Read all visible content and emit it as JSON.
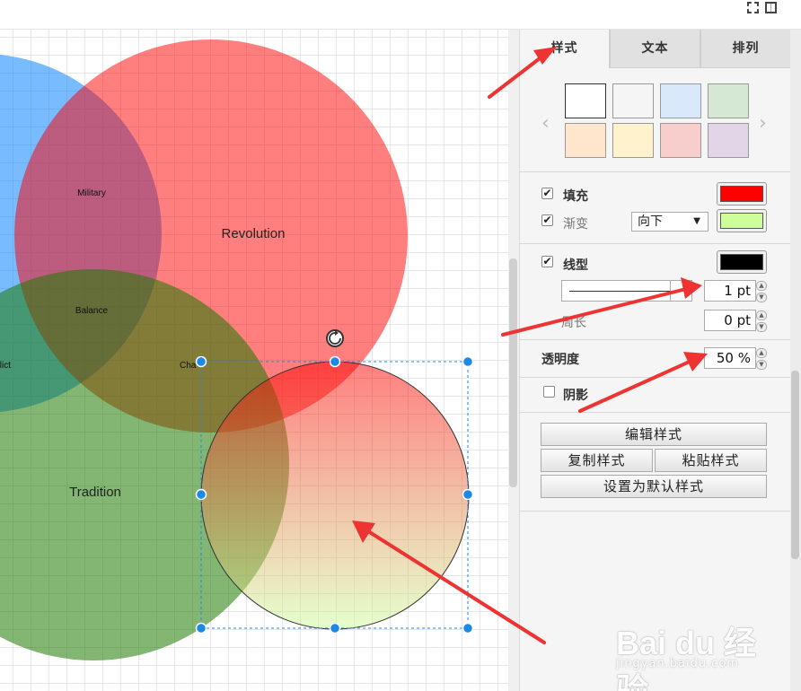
{
  "diagram": {
    "labels": {
      "revolution": "Revolution",
      "military": "Military",
      "balance": "Balance",
      "conflict": "flict",
      "chaos": "Cha",
      "tradition": "Tradition"
    }
  },
  "panel": {
    "tabs": [
      "样式",
      "文本",
      "排列"
    ],
    "swatch_colors": [
      "#ffffff",
      "#f5f5f5",
      "#dae8fc",
      "#d5e8d4",
      "#ffe6cc",
      "#fff2cc",
      "#f8cecc",
      "#e1d5e7"
    ],
    "fill": {
      "label": "填充",
      "checked": true,
      "color": "#ff0000"
    },
    "gradient": {
      "label": "渐变",
      "checked": true,
      "direction": "向下",
      "color": "#ccff99"
    },
    "line": {
      "label": "线型",
      "checked": true,
      "color": "#000000",
      "width": "1 pt"
    },
    "perimeter": {
      "label": "周长",
      "value": "0 pt"
    },
    "opacity": {
      "label": "透明度",
      "value": "50 %"
    },
    "shadow": {
      "label": "阴影",
      "checked": false
    },
    "buttons": {
      "edit_style": "编辑样式",
      "copy_style": "复制样式",
      "paste_style": "粘贴样式",
      "set_default": "设置为默认样式"
    }
  },
  "watermark": {
    "main": "Bai du 经验",
    "sub": "jingyan.baidu.com"
  },
  "colors": {
    "annotation_arrow": "#ee3333",
    "selection": "#1e88e5"
  }
}
